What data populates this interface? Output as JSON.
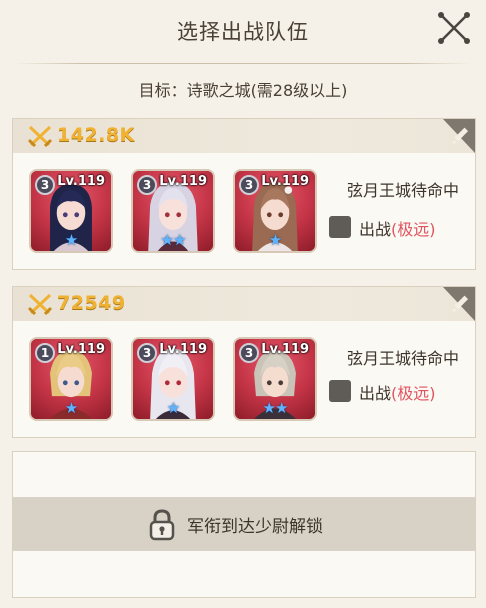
{
  "header": {
    "title": "选择出战队伍",
    "objective": "目标：诗歌之城(需28级以上)"
  },
  "teams": [
    {
      "power": "142.8K",
      "heroes": [
        {
          "rank": "3",
          "level": "Lv.119",
          "stars": "★",
          "portrait": "dark-hair-girl"
        },
        {
          "rank": "3",
          "level": "Lv.119",
          "stars": "★★",
          "portrait": "silver-hair-girl"
        },
        {
          "rank": "3",
          "level": "Lv.119",
          "stars": "★",
          "portrait": "brown-hair-girl"
        }
      ],
      "status": "弦月王城待命中",
      "deploy_label": "出战",
      "deploy_distance": "(极远)"
    },
    {
      "power": "72549",
      "heroes": [
        {
          "rank": "1",
          "level": "Lv.119",
          "stars": "★",
          "portrait": "blonde-boy"
        },
        {
          "rank": "3",
          "level": "Lv.119",
          "stars": "★",
          "portrait": "white-hair-girl"
        },
        {
          "rank": "3",
          "level": "Lv.119",
          "stars": "★★",
          "portrait": "grey-hair-boy"
        }
      ],
      "status": "弦月王城待命中",
      "deploy_label": "出战",
      "deploy_distance": "(极远)"
    }
  ],
  "locked_slot": {
    "text": "军衔到达少尉解锁"
  },
  "colors": {
    "power": "#f0b232",
    "distance": "#e0545f",
    "hero_bg": "#c23445",
    "star": "#5fb4ff"
  }
}
